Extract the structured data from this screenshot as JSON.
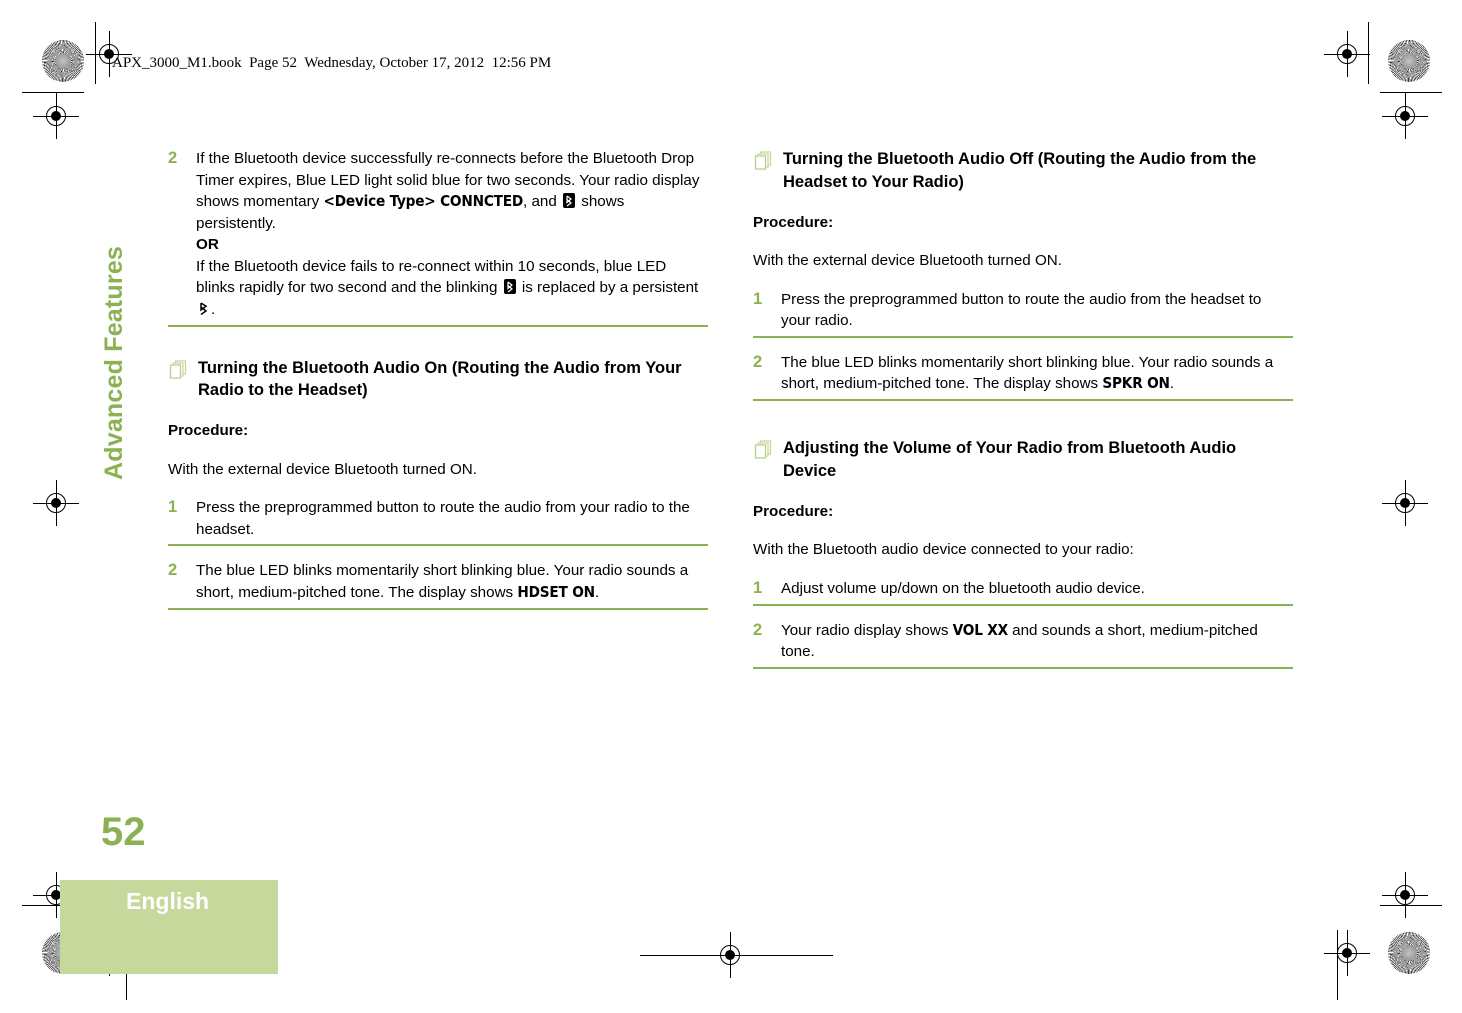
{
  "file_header": "APX_3000_M1.book  Page 52  Wednesday, October 17, 2012  12:56 PM",
  "chapter": {
    "tab_label": "Advanced Features",
    "page_number": "52",
    "language": "English"
  },
  "colors": {
    "accent_green": "#8cb152",
    "block_green": "#c6d89b",
    "text": "#000000"
  },
  "left_column": {
    "step2": {
      "number": "2",
      "text_part1": "If the Bluetooth device successfully re-connects before the Bluetooth Drop Timer expires, Blue LED light solid blue for two seconds. Your radio display shows momentary ",
      "display1": "<Device Type> CONNCTED",
      "text_part2": ", and ",
      "icon1": "bluetooth-boxed-icon",
      "text_part3": " shows persistently.",
      "or_label": "OR",
      "text_part4": "If the Bluetooth device fails to re-connect within 10 seconds, blue LED blinks rapidly for two second and the blinking ",
      "icon2": "bluetooth-boxed-icon",
      "text_part5": " is replaced by a persistent ",
      "icon3": "bluetooth-plain-icon",
      "text_part6": "."
    },
    "section": {
      "icon": "stacked-pages-icon",
      "title": "Turning the Bluetooth Audio On (Routing the Audio from Your Radio to the Headset)",
      "procedure_label": "Procedure:",
      "intro": "With the external device Bluetooth turned ON.",
      "steps": [
        {
          "number": "1",
          "text": "Press the preprogrammed button to route the audio from your radio to the headset."
        },
        {
          "number": "2",
          "text_before": "The blue LED blinks momentarily short blinking blue. Your radio sounds a short, medium-pitched tone. The display shows ",
          "display": "HDSET ON",
          "text_after": "."
        }
      ]
    }
  },
  "right_column": {
    "section1": {
      "icon": "stacked-pages-icon",
      "title": "Turning the Bluetooth Audio Off (Routing the Audio from the Headset to Your Radio)",
      "procedure_label": "Procedure:",
      "intro": "With the external device Bluetooth turned ON.",
      "steps": [
        {
          "number": "1",
          "text": "Press the preprogrammed button to route the audio from the headset to your radio."
        },
        {
          "number": "2",
          "text_before": "The blue LED blinks momentarily short blinking blue. Your radio sounds a short, medium-pitched tone. The display shows ",
          "display": "SPKR ON",
          "text_after": "."
        }
      ]
    },
    "section2": {
      "icon": "stacked-pages-icon",
      "title": "Adjusting the Volume of Your Radio from Bluetooth Audio Device",
      "procedure_label": "Procedure:",
      "intro": "With the Bluetooth audio device connected to your radio:",
      "steps": [
        {
          "number": "1",
          "text": "Adjust volume up/down on the bluetooth audio device."
        },
        {
          "number": "2",
          "text_before": "Your radio display shows ",
          "display": "VOL XX",
          "text_after": " and sounds a short, medium-pitched tone."
        }
      ]
    }
  }
}
